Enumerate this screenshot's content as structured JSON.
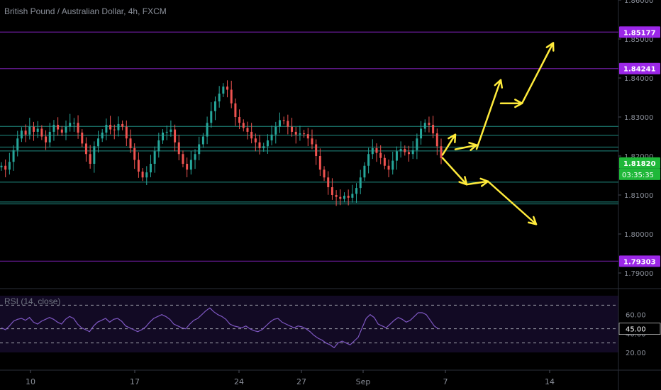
{
  "header": {
    "title": "British Pound / Australian Dollar, 4h, FXCM"
  },
  "rsi": {
    "label": "RSI (14, close)",
    "ticks": [
      "60.00",
      "40.00",
      "20.00"
    ],
    "marker": "45.00"
  },
  "price_axis": {
    "ticks": [
      "1.86000",
      "1.85000",
      "1.84000",
      "1.83000",
      "1.82000",
      "1.81000",
      "1.80000",
      "1.79000"
    ],
    "tags": [
      {
        "text": "1.85177",
        "price": 1.85177,
        "color": "#9c27e8"
      },
      {
        "text": "1.84241",
        "price": 1.84241,
        "color": "#9c27e8"
      },
      {
        "text": "1.81820",
        "price": 1.8182,
        "color": "#1fb839"
      },
      {
        "text": "1.79303",
        "price": 1.79303,
        "color": "#9c27e8"
      }
    ],
    "countdown": "03:35:35"
  },
  "time_axis": {
    "ticks": [
      "10",
      "17",
      "24",
      "27",
      "Sep",
      "7",
      "14"
    ]
  },
  "levels": {
    "resistance_support": [
      1.85177,
      1.84241,
      1.79303
    ],
    "zones": [
      1.8276,
      1.8253,
      1.8223,
      1.8213,
      1.8133,
      1.8082,
      1.8077
    ]
  },
  "colors": {
    "up": "#26a69a",
    "down": "#ef5350",
    "level": "#6a1b9a",
    "zone": "#26a69a",
    "arrow_bull": "#ffeb3b",
    "arrow_bear": "#ffeb3b",
    "rsi_line": "#7e57c2"
  },
  "chart_data": {
    "type": "candlestick",
    "title": "British Pound / Australian Dollar, 4h, FXCM",
    "ylim": [
      1.786,
      1.86
    ],
    "close_path": [
      1.8175,
      1.8165,
      1.8185,
      1.8215,
      1.8245,
      1.8265,
      1.8255,
      1.8275,
      1.8262,
      1.827,
      1.825,
      1.8235,
      1.8262,
      1.828,
      1.8268,
      1.826,
      1.8275,
      1.8285,
      1.8285,
      1.826,
      1.8232,
      1.8205,
      1.818,
      1.8225,
      1.8245,
      1.826,
      1.828,
      1.8268,
      1.8266,
      1.8282,
      1.8275,
      1.8245,
      1.822,
      1.819,
      1.816,
      1.8145,
      1.8158,
      1.818,
      1.8212,
      1.824,
      1.826,
      1.8262,
      1.8268,
      1.8235,
      1.8205,
      1.818,
      1.8165,
      1.819,
      1.8205,
      1.823,
      1.825,
      1.8285,
      1.8315,
      1.834,
      1.836,
      1.8378,
      1.837,
      1.8335,
      1.83,
      1.8285,
      1.8272,
      1.8262,
      1.8245,
      1.8235,
      1.822,
      1.8225,
      1.824,
      1.8255,
      1.8275,
      1.8292,
      1.829,
      1.8275,
      1.8262,
      1.8255,
      1.8258,
      1.8256,
      1.8245,
      1.823,
      1.82,
      1.8165,
      1.8145,
      1.812,
      1.81,
      1.8095,
      1.809,
      1.8098,
      1.8093,
      1.8103,
      1.8118,
      1.8145,
      1.8175,
      1.8205,
      1.822,
      1.8208,
      1.8195,
      1.8175,
      1.8165,
      1.8188,
      1.8212,
      1.8218,
      1.821,
      1.8205,
      1.8215,
      1.8245,
      1.827,
      1.8285,
      1.828,
      1.8258,
      1.8225,
      1.8195
    ],
    "rsi": {
      "overbought": 70,
      "oversold": 30,
      "mid": 45,
      "values": [
        46,
        44,
        48,
        53,
        55,
        56,
        54,
        57,
        52,
        50,
        53,
        55,
        57,
        55,
        52,
        50,
        55,
        58,
        56,
        50,
        46,
        44,
        42,
        48,
        52,
        54,
        56,
        52,
        55,
        56,
        53,
        48,
        46,
        44,
        42,
        44,
        47,
        52,
        56,
        58,
        60,
        58,
        55,
        50,
        48,
        46,
        45,
        50,
        54,
        56,
        60,
        64,
        67,
        63,
        60,
        58,
        55,
        50,
        48,
        47,
        46,
        48,
        45,
        43,
        42,
        44,
        48,
        52,
        55,
        56,
        52,
        50,
        48,
        46,
        48,
        47,
        45,
        42,
        38,
        35,
        33,
        30,
        28,
        25,
        30,
        32,
        30,
        28,
        32,
        36,
        46,
        56,
        60,
        57,
        50,
        48,
        46,
        50,
        54,
        57,
        55,
        52,
        54,
        58,
        62,
        62,
        60,
        54,
        48,
        45
      ]
    },
    "projection_bull": [
      [
        1.8203,
        1.8255
      ],
      [
        1.8217,
        1.8228
      ],
      [
        1.8218,
        1.8395
      ],
      [
        1.8335,
        1.8335
      ],
      [
        1.8335,
        1.849
      ]
    ],
    "projection_bear": [
      [
        1.8195,
        1.8127
      ],
      [
        1.8127,
        1.8135
      ],
      [
        1.8135,
        1.8025
      ]
    ]
  }
}
